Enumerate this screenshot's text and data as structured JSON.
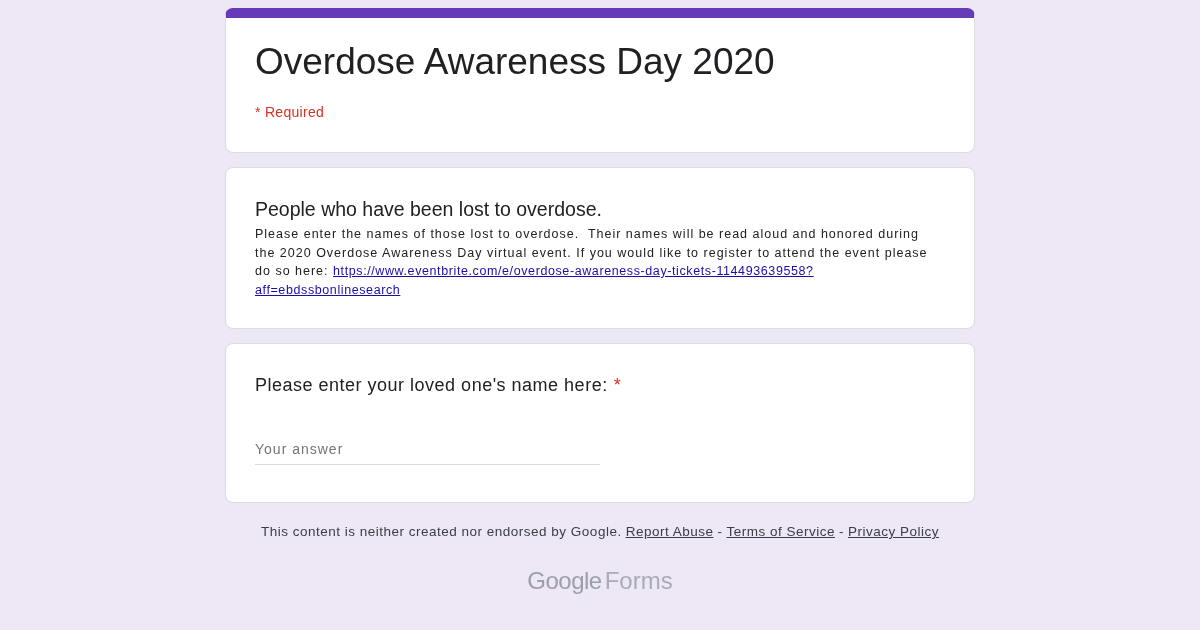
{
  "header": {
    "title": "Overdose Awareness Day 2020",
    "required_note": "* Required"
  },
  "section": {
    "heading": "People who have been lost to overdose.",
    "description": "Please enter the names of those lost to overdose.  Their names will be read aloud and honored during the 2020 Overdose Awareness Day virtual event. If you would like to register to attend the event please do so here:",
    "link_lines": [
      "https://www.eventbrite.com/e/overdose-awareness-day-tickets-114493639558?",
      "aff=ebdssbonlinesearch"
    ]
  },
  "question": {
    "label": "Please enter your loved one's name here:",
    "required_mark": "*",
    "placeholder": "Your answer"
  },
  "footer": {
    "items": [
      {
        "kind": "text",
        "text": "This content is neither created nor endorsed by Google."
      },
      {
        "kind": "link",
        "text": "Report Abuse"
      },
      {
        "kind": "separator",
        "text": "-"
      },
      {
        "kind": "link",
        "text": "Terms of Service"
      },
      {
        "kind": "separator",
        "text": "-"
      },
      {
        "kind": "link",
        "text": "Privacy Policy"
      }
    ],
    "logo": {
      "brand": "Google",
      "product": "Forms"
    }
  }
}
